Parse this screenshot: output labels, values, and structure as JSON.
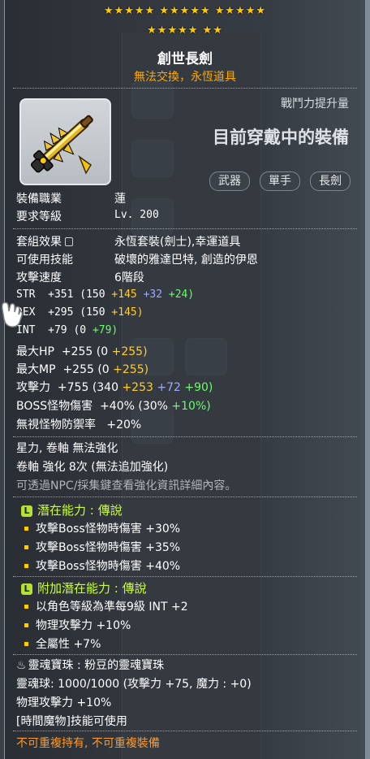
{
  "stars": {
    "row1": "★★★★★ ★★★★★ ★★★★★",
    "row2": "★★★★★ ★★"
  },
  "item": {
    "name": "創世長劍",
    "subtitle": "無法交換，永恆道具",
    "combat_power_label": "戰鬥力提升量",
    "equip_state": "目前穿戴中的裝備",
    "tags": [
      "武器",
      "單手",
      "長劍"
    ],
    "job_label": "裝備職業",
    "job_value": "蓮",
    "req_level_label": "要求等級",
    "req_level_value": "Lv. 200",
    "set_label": "套組效果",
    "set_value": "永恆套裝(劍士),幸運道具",
    "skills_label": "可使用技能",
    "skills_value": "破壞的雅達巴特, 創造的伊恩",
    "attack_speed_label": "攻擊速度",
    "attack_speed_value": "6階段"
  },
  "stats": {
    "str": {
      "label": "STR",
      "total": "+351",
      "base": "(150",
      "bonus1": "+145",
      "bonus2": "+32",
      "bonus3": "+24)"
    },
    "dex": {
      "label": "DEX",
      "total": "+295",
      "base": "(150",
      "bonus1": "+145)"
    },
    "int": {
      "label": "INT",
      "total": "+79",
      "base": "(0",
      "bonus1": "+79)"
    },
    "maxhp": {
      "label": "最大HP",
      "total": "+255",
      "base": "(0",
      "bonus1": "+255)"
    },
    "maxmp": {
      "label": "最大MP",
      "total": "+255",
      "base": "(0",
      "bonus1": "+255)"
    },
    "atk": {
      "label": "攻擊力",
      "total": "+755",
      "base": "(340",
      "bonus1": "+253",
      "bonus2": "+72",
      "bonus3": "+90)"
    },
    "boss": {
      "label": "BOSS怪物傷害",
      "total": "+40%",
      "base": "(30%",
      "bonus1": "+10%)"
    },
    "ignore_def": {
      "label": "無視怪物防禦率",
      "total": "+20%"
    }
  },
  "enhance": {
    "line1": "星力, 卷軸 無法強化",
    "line2": "卷軸 強化 8次 (無法追加強化)",
    "line3": "可透過NPC/採集鍵查看強化資訊詳細內容。"
  },
  "potential": {
    "badge": "L",
    "title": "潛在能力 : 傳說",
    "lines": [
      "攻擊Boss怪物時傷害 +30%",
      "攻擊Boss怪物時傷害 +35%",
      "攻擊Boss怪物時傷害 +40%"
    ]
  },
  "additional": {
    "badge": "L",
    "title": "附加潛在能力 : 傳說",
    "lines": [
      "以角色等級為準每9級 INT +2",
      "物理攻擊力 +10%",
      "全屬性 +7%"
    ]
  },
  "soul": {
    "title": "靈魂寶珠 : 粉豆的靈魂寶珠",
    "orb": "靈魂球:  1000/1000 (攻擊力 +75, 魔力 : +0)",
    "phys": "物理攻擊力 +10%",
    "skill": "[時間魔物]技能可使用"
  },
  "footer": "不可重複持有, 不可重複裝備",
  "colors": {
    "star": "#ffcc00",
    "subtitle": "#ffaa00",
    "potential": "#ccff33",
    "yellow_bonus": "#ffcc33",
    "blue_bonus": "#9fa8ff",
    "green_bonus": "#66ff66",
    "footer": "#ff9922"
  }
}
